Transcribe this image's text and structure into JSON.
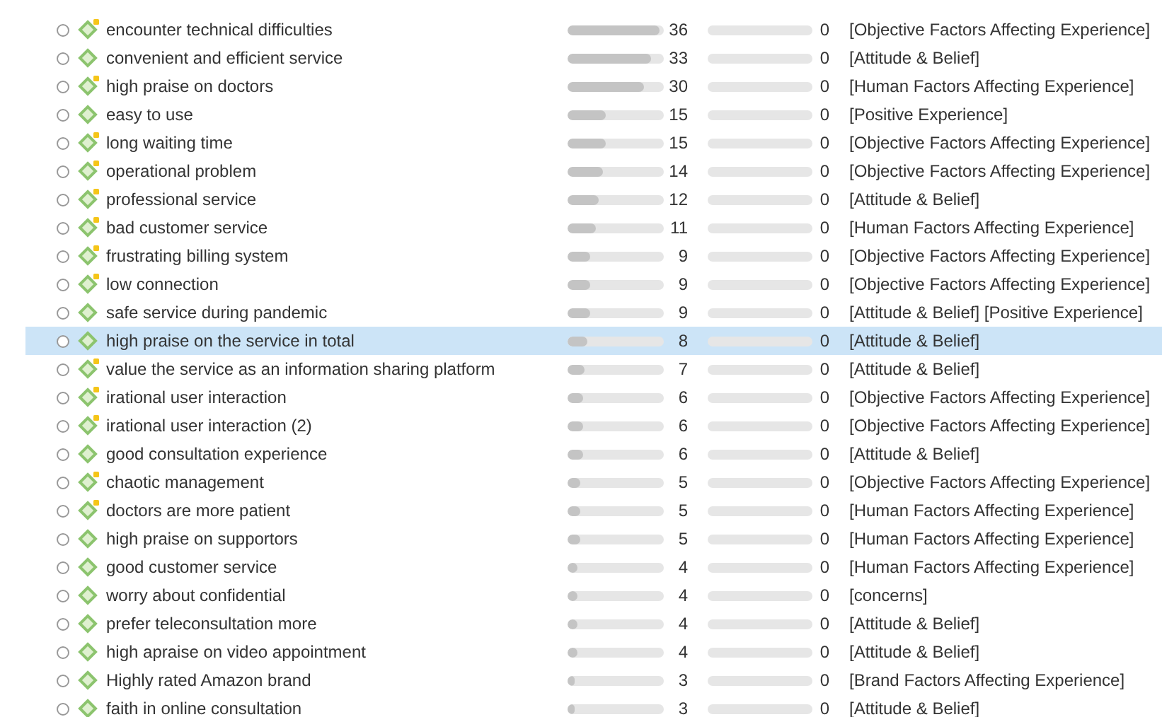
{
  "codes": [
    {
      "name": "encounter technical difficulties",
      "memo": true,
      "selected": false,
      "count": "36",
      "level": 0.95,
      "count2": "0",
      "categories": "[Objective Factors Affecting Experience]"
    },
    {
      "name": "convenient and efficient service",
      "memo": false,
      "selected": false,
      "count": "33",
      "level": 0.87,
      "count2": "0",
      "categories": "[Attitude & Belief]"
    },
    {
      "name": "high praise on doctors",
      "memo": true,
      "selected": false,
      "count": "30",
      "level": 0.79,
      "count2": "0",
      "categories": "[Human Factors Affecting Experience]"
    },
    {
      "name": "easy to use",
      "memo": false,
      "selected": false,
      "count": "15",
      "level": 0.4,
      "count2": "0",
      "categories": "[Positive Experience]"
    },
    {
      "name": "long waiting time",
      "memo": true,
      "selected": false,
      "count": "15",
      "level": 0.4,
      "count2": "0",
      "categories": "[Objective Factors Affecting Experience]"
    },
    {
      "name": "operational problem",
      "memo": true,
      "selected": false,
      "count": "14",
      "level": 0.37,
      "count2": "0",
      "categories": "[Objective Factors Affecting Experience]"
    },
    {
      "name": "professional service",
      "memo": true,
      "selected": false,
      "count": "12",
      "level": 0.32,
      "count2": "0",
      "categories": "[Attitude & Belief]"
    },
    {
      "name": "bad customer service",
      "memo": true,
      "selected": false,
      "count": "11",
      "level": 0.29,
      "count2": "0",
      "categories": "[Human Factors Affecting Experience]"
    },
    {
      "name": "frustrating billing system",
      "memo": true,
      "selected": false,
      "count": "9",
      "level": 0.24,
      "count2": "0",
      "categories": "[Objective Factors Affecting Experience]"
    },
    {
      "name": "low connection",
      "memo": true,
      "selected": false,
      "count": "9",
      "level": 0.24,
      "count2": "0",
      "categories": "[Objective Factors Affecting Experience]"
    },
    {
      "name": "safe service during pandemic",
      "memo": false,
      "selected": false,
      "count": "9",
      "level": 0.24,
      "count2": "0",
      "categories": "[Attitude & Belief] [Positive Experience]"
    },
    {
      "name": "high praise on the service in total",
      "memo": false,
      "selected": true,
      "count": "8",
      "level": 0.21,
      "count2": "0",
      "categories": "[Attitude & Belief]"
    },
    {
      "name": "value the service as an information sharing platform",
      "memo": true,
      "selected": false,
      "count": "7",
      "level": 0.18,
      "count2": "0",
      "categories": "[Attitude & Belief]"
    },
    {
      "name": "irational user interaction",
      "memo": true,
      "selected": false,
      "count": "6",
      "level": 0.16,
      "count2": "0",
      "categories": "[Objective Factors Affecting Experience]"
    },
    {
      "name": "irational user interaction (2)",
      "memo": true,
      "selected": false,
      "count": "6",
      "level": 0.16,
      "count2": "0",
      "categories": "[Objective Factors Affecting Experience]"
    },
    {
      "name": "good consultation experience",
      "memo": false,
      "selected": false,
      "count": "6",
      "level": 0.16,
      "count2": "0",
      "categories": "[Attitude & Belief]"
    },
    {
      "name": "chaotic management",
      "memo": true,
      "selected": false,
      "count": "5",
      "level": 0.13,
      "count2": "0",
      "categories": "[Objective Factors Affecting Experience]"
    },
    {
      "name": "doctors are more patient",
      "memo": true,
      "selected": false,
      "count": "5",
      "level": 0.13,
      "count2": "0",
      "categories": "[Human Factors Affecting Experience]"
    },
    {
      "name": "high praise on supportors",
      "memo": false,
      "selected": false,
      "count": "5",
      "level": 0.13,
      "count2": "0",
      "categories": "[Human Factors Affecting Experience]"
    },
    {
      "name": "good customer service",
      "memo": false,
      "selected": false,
      "count": "4",
      "level": 0.11,
      "count2": "0",
      "categories": "[Human Factors Affecting Experience]"
    },
    {
      "name": "worry about confidential",
      "memo": false,
      "selected": false,
      "count": "4",
      "level": 0.11,
      "count2": "0",
      "categories": "[concerns]"
    },
    {
      "name": "prefer teleconsultation more",
      "memo": false,
      "selected": false,
      "count": "4",
      "level": 0.11,
      "count2": "0",
      "categories": "[Attitude & Belief]"
    },
    {
      "name": "high apraise on video appointment",
      "memo": false,
      "selected": false,
      "count": "4",
      "level": 0.11,
      "count2": "0",
      "categories": "[Attitude & Belief]"
    },
    {
      "name": "Highly rated Amazon brand",
      "memo": false,
      "selected": false,
      "count": "3",
      "level": 0.08,
      "count2": "0",
      "categories": "[Brand Factors Affecting Experience]"
    },
    {
      "name": "faith in online consultation",
      "memo": false,
      "selected": false,
      "count": "3",
      "level": 0.08,
      "count2": "0",
      "categories": "[Attitude & Belief]"
    }
  ]
}
